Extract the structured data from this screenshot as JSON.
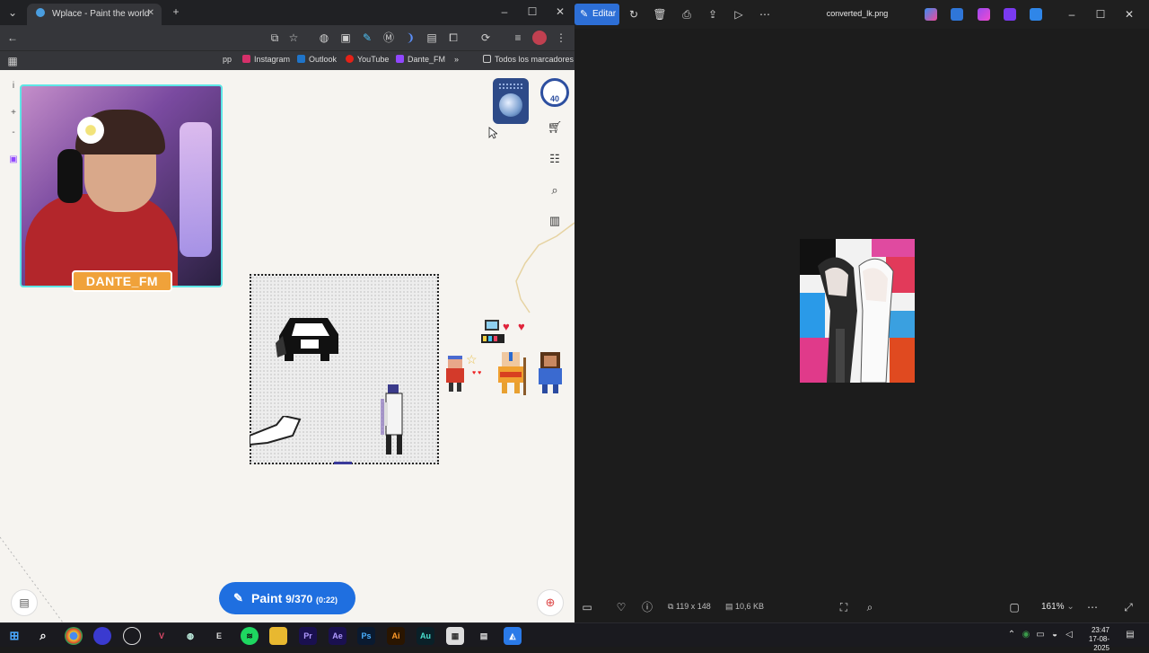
{
  "browser": {
    "tab_title": "Wplace - Paint the world",
    "bookmarks": [
      {
        "label": "pp"
      },
      {
        "label": "Instagram"
      },
      {
        "label": "Outlook"
      },
      {
        "label": "YouTube"
      },
      {
        "label": "Dante_FM"
      },
      {
        "label": "»"
      },
      {
        "label": "Todos los marcadores"
      }
    ]
  },
  "stream": {
    "streamer_name": "DANTE_FM"
  },
  "wplace": {
    "level_badge": "40",
    "paint_label": "Paint",
    "paint_count": "9/370",
    "paint_timer": "(0:22)"
  },
  "viewer": {
    "edit_label": "Editar",
    "filename": "converted_lk.png",
    "dimensions": "119 x 148",
    "filesize": "10,6 KB",
    "zoom": "161%"
  },
  "taskbar": {
    "time": "23:47",
    "date": "17-08-2025",
    "apps": [
      "Pr",
      "Ae",
      "Ps",
      "Ai",
      "Au"
    ]
  },
  "colors": {
    "accent_blue": "#1f6fe0",
    "edit_blue": "#2d6fd6",
    "badge_orange": "#f0a23a",
    "cam_border": "#5ee6e6"
  }
}
